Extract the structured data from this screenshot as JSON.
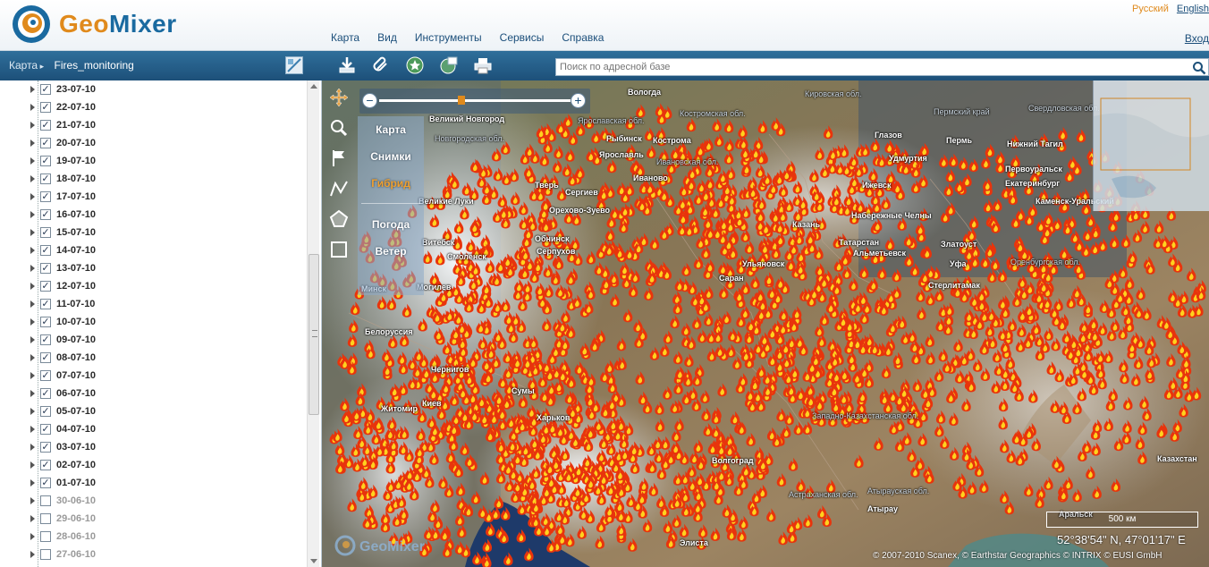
{
  "header": {
    "logo_text": "GeoMixer",
    "menu": [
      "Карта",
      "Вид",
      "Инструменты",
      "Сервисы",
      "Справка"
    ],
    "lang_ru": "Русский",
    "lang_en": "English",
    "login": "Вход"
  },
  "toolbar": {
    "breadcrumb_root": "Карта",
    "breadcrumb_layer": "Fires_monitoring",
    "search_placeholder": "Поиск по адресной базе",
    "tools": [
      "download-icon",
      "paperclip-icon",
      "favorites-icon",
      "globe-icon",
      "print-icon"
    ]
  },
  "layers": [
    {
      "label": "23-07-10",
      "checked": true
    },
    {
      "label": "22-07-10",
      "checked": true
    },
    {
      "label": "21-07-10",
      "checked": true
    },
    {
      "label": "20-07-10",
      "checked": true
    },
    {
      "label": "19-07-10",
      "checked": true
    },
    {
      "label": "18-07-10",
      "checked": true
    },
    {
      "label": "17-07-10",
      "checked": true
    },
    {
      "label": "16-07-10",
      "checked": true
    },
    {
      "label": "15-07-10",
      "checked": true
    },
    {
      "label": "14-07-10",
      "checked": true
    },
    {
      "label": "13-07-10",
      "checked": true
    },
    {
      "label": "12-07-10",
      "checked": true
    },
    {
      "label": "11-07-10",
      "checked": true
    },
    {
      "label": "10-07-10",
      "checked": true
    },
    {
      "label": "09-07-10",
      "checked": true
    },
    {
      "label": "08-07-10",
      "checked": true
    },
    {
      "label": "07-07-10",
      "checked": true
    },
    {
      "label": "06-07-10",
      "checked": true
    },
    {
      "label": "05-07-10",
      "checked": true
    },
    {
      "label": "04-07-10",
      "checked": true
    },
    {
      "label": "03-07-10",
      "checked": true
    },
    {
      "label": "02-07-10",
      "checked": true
    },
    {
      "label": "01-07-10",
      "checked": true
    },
    {
      "label": "30-06-10",
      "checked": false
    },
    {
      "label": "29-06-10",
      "checked": false
    },
    {
      "label": "28-06-10",
      "checked": false
    },
    {
      "label": "27-06-10",
      "checked": false
    }
  ],
  "map": {
    "basemaps": [
      "Карта",
      "Снимки",
      "Гибрид"
    ],
    "active_basemap": "Гибрид",
    "overlays": [
      "Погода",
      "Ветер"
    ],
    "scale_label": "500 км",
    "coordinates": "52°38'54\" N, 47°01'17\" E",
    "copyright": "© 2007-2010 Scanex, © Earthstar Geographics © INTRIX © EUSI GmbH",
    "watermark": "GeoMixer",
    "cities": [
      {
        "name": "Великий Новгород"
      },
      {
        "name": "Ярославль"
      },
      {
        "name": "Рыбинск"
      },
      {
        "name": "Кострома"
      },
      {
        "name": "Иваново"
      },
      {
        "name": "Тверь"
      },
      {
        "name": "Сергиев"
      },
      {
        "name": "Великие Луки"
      },
      {
        "name": "Смоленск"
      },
      {
        "name": "Витебск"
      },
      {
        "name": "Минск"
      },
      {
        "name": "Могилев"
      },
      {
        "name": "Серпухов"
      },
      {
        "name": "Обнинск"
      },
      {
        "name": "Орехово-Зуево"
      },
      {
        "name": "Киев"
      },
      {
        "name": "Житомир"
      },
      {
        "name": "Чернигов"
      },
      {
        "name": "Харьков"
      },
      {
        "name": "Сумы"
      },
      {
        "name": "Ульяновск"
      },
      {
        "name": "Саран"
      },
      {
        "name": "Казань"
      },
      {
        "name": "Набережные Челны"
      },
      {
        "name": "Ижевск"
      },
      {
        "name": "Глазов"
      },
      {
        "name": "Пермь"
      },
      {
        "name": "Нижний Тагил"
      },
      {
        "name": "Екатеринбург"
      },
      {
        "name": "Первоуральск"
      },
      {
        "name": "Каменск-Уральский"
      },
      {
        "name": "Уфа"
      },
      {
        "name": "Стерлитамак"
      },
      {
        "name": "Златоуст"
      },
      {
        "name": "Альметьевск"
      },
      {
        "name": "Волгоград"
      },
      {
        "name": "Элиста"
      },
      {
        "name": "Атырау"
      },
      {
        "name": "Аральск"
      },
      {
        "name": "Казахстан"
      },
      {
        "name": "Белоруссия"
      },
      {
        "name": "Татарстан"
      },
      {
        "name": "Удмуртия"
      },
      {
        "name": "Вологда"
      }
    ],
    "regions": [
      {
        "name": "Кировская обл."
      },
      {
        "name": "Костромская обл."
      },
      {
        "name": "Ярославская обл."
      },
      {
        "name": "Новгородская обл."
      },
      {
        "name": "Ивановская обл."
      },
      {
        "name": "Пермский край"
      },
      {
        "name": "Свердловская обл."
      },
      {
        "name": "Оренбургская обл."
      },
      {
        "name": "Астраханская обл."
      },
      {
        "name": "Западно-Казахстанская обл."
      },
      {
        "name": "Атырауская обл."
      }
    ]
  }
}
